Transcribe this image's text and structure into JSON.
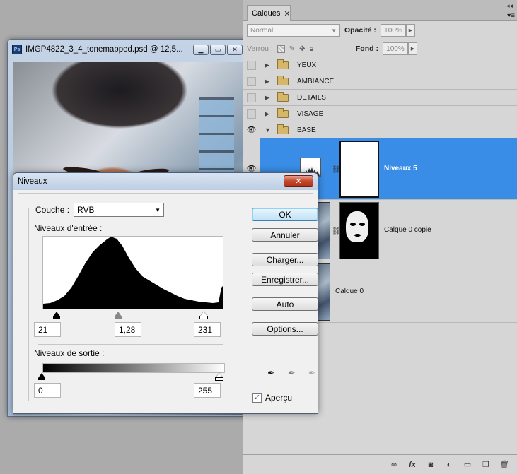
{
  "doc_window": {
    "title": "IMGP4822_3_4_tonemapped.psd @ 12,5...",
    "app_badge": "Ps"
  },
  "layers_panel": {
    "tab_label": "Calques",
    "blend_mode": "Normal",
    "opacity_label": "Opacité :",
    "opacity_value": "100%",
    "lock_label": "Verrou :",
    "fill_label": "Fond :",
    "fill_value": "100%",
    "groups": [
      {
        "name": "YEUX",
        "visible": false
      },
      {
        "name": "AMBIANCE",
        "visible": false
      },
      {
        "name": "DETAILS",
        "visible": false
      },
      {
        "name": "VISAGE",
        "visible": false
      },
      {
        "name": "BASE",
        "visible": true,
        "expanded": true
      }
    ],
    "layers": [
      {
        "name": "Niveaux 5",
        "selected": true,
        "type": "adjustment"
      },
      {
        "name": "Calque 0 copie",
        "selected": false,
        "type": "masked"
      },
      {
        "name": "Calque 0",
        "selected": false,
        "type": "pixel"
      }
    ],
    "bottom_icons": [
      "link-icon",
      "fx-icon",
      "mask-icon",
      "adjustment-icon",
      "folder-icon",
      "new-layer-icon",
      "trash-icon"
    ]
  },
  "levels_dialog": {
    "title": "Niveaux",
    "channel_label": "Couche :",
    "channel_value": "RVB",
    "input_label": "Niveaux d'entrée :",
    "input_black": "21",
    "input_gamma": "1,28",
    "input_white": "231",
    "output_label": "Niveaux de sortie :",
    "output_black": "0",
    "output_white": "255",
    "buttons": {
      "ok": "OK",
      "cancel": "Annuler",
      "load": "Charger...",
      "save": "Enregistrer...",
      "auto": "Auto",
      "options": "Options..."
    },
    "preview_label": "Aperçu",
    "preview_checked": true
  },
  "colors": {
    "selection": "#3a8de6",
    "close_button": "#c3452b"
  }
}
